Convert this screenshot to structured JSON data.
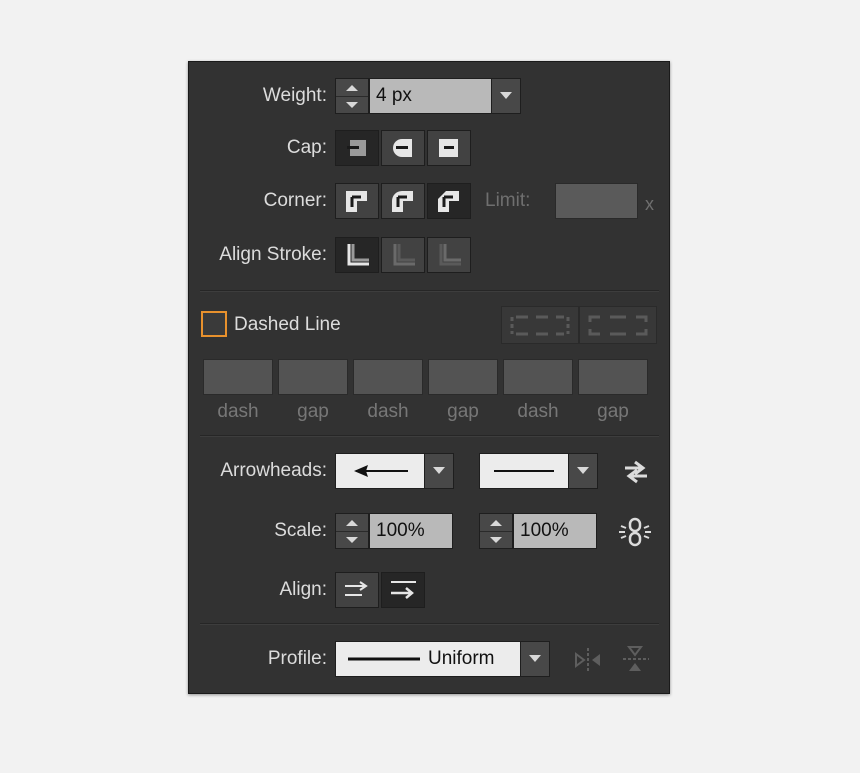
{
  "labels": {
    "weight": "Weight:",
    "cap": "Cap:",
    "corner": "Corner:",
    "limit": "Limit:",
    "limit_suffix": "x",
    "align_stroke": "Align Stroke:",
    "dashed_line": "Dashed Line",
    "arrowheads": "Arrowheads:",
    "scale": "Scale:",
    "align": "Align:",
    "profile": "Profile:"
  },
  "weight": {
    "value": "4 px"
  },
  "limit": {
    "value": ""
  },
  "dashed": {
    "checked": false,
    "fields": [
      {
        "label": "dash",
        "value": ""
      },
      {
        "label": "gap",
        "value": ""
      },
      {
        "label": "dash",
        "value": ""
      },
      {
        "label": "gap",
        "value": ""
      },
      {
        "label": "dash",
        "value": ""
      },
      {
        "label": "gap",
        "value": ""
      }
    ]
  },
  "scale": {
    "start": "100%",
    "end": "100%"
  },
  "profile": {
    "value": "Uniform"
  },
  "colors": {
    "panel": "#323232",
    "checkbox_accent": "#e8912d",
    "field": "#b9b9b9"
  },
  "icons": [
    "spinner-icon",
    "chevron-down-icon",
    "butt-cap-icon",
    "round-cap-icon",
    "projecting-cap-icon",
    "miter-join-icon",
    "round-join-icon",
    "bevel-join-icon",
    "align-center-icon",
    "align-inside-icon",
    "align-outside-icon",
    "dash-preserve-icon",
    "dash-align-corners-icon",
    "arrow-left-icon",
    "line-icon",
    "swap-arrowheads-icon",
    "link-scale-icon",
    "arrow-extend-icon",
    "arrow-place-icon",
    "flip-horizontal-icon",
    "flip-vertical-icon"
  ]
}
